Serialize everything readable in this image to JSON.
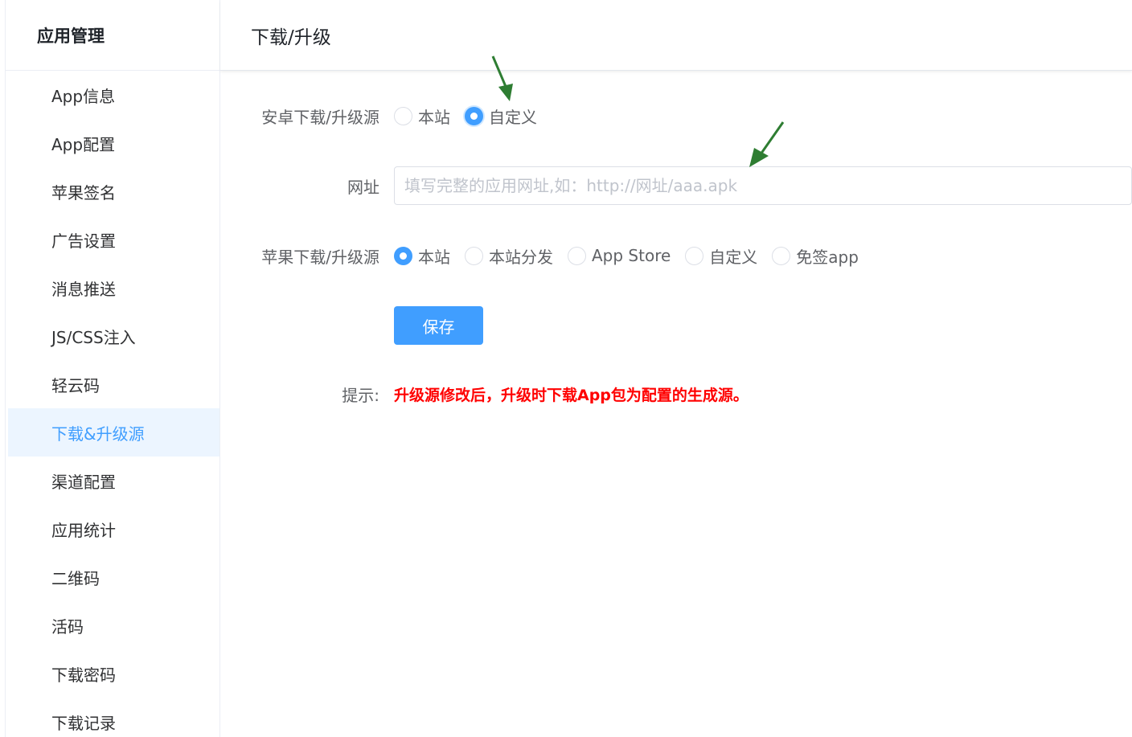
{
  "sidebar": {
    "title": "应用管理",
    "items": [
      {
        "label": "App信息"
      },
      {
        "label": "App配置"
      },
      {
        "label": "苹果签名"
      },
      {
        "label": "广告设置"
      },
      {
        "label": "消息推送"
      },
      {
        "label": "JS/CSS注入"
      },
      {
        "label": "轻云码"
      },
      {
        "label": "下载&升级源",
        "active": true
      },
      {
        "label": "渠道配置"
      },
      {
        "label": "应用统计"
      },
      {
        "label": "二维码"
      },
      {
        "label": "活码"
      },
      {
        "label": "下载密码"
      },
      {
        "label": "下载记录"
      }
    ]
  },
  "main": {
    "title": "下载/升级",
    "android": {
      "label": "安卓下载/升级源",
      "options": [
        "本站",
        "自定义"
      ],
      "selected": "自定义"
    },
    "url": {
      "label": "网址",
      "value": "",
      "placeholder": "填写完整的应用网址,如：http://网址/aaa.apk"
    },
    "ios": {
      "label": "苹果下载/升级源",
      "options": [
        "本站",
        "本站分发",
        "App Store",
        "自定义",
        "免签app"
      ],
      "selected": "本站"
    },
    "save_label": "保存",
    "tip": {
      "label": "提示:",
      "text": "升级源修改后，升级时下载App包为配置的生成源。"
    }
  },
  "colors": {
    "primary": "#409eff",
    "active_bg": "#ecf5ff",
    "tip": "#ff0000",
    "annotation_arrow": "#2e7d32"
  }
}
